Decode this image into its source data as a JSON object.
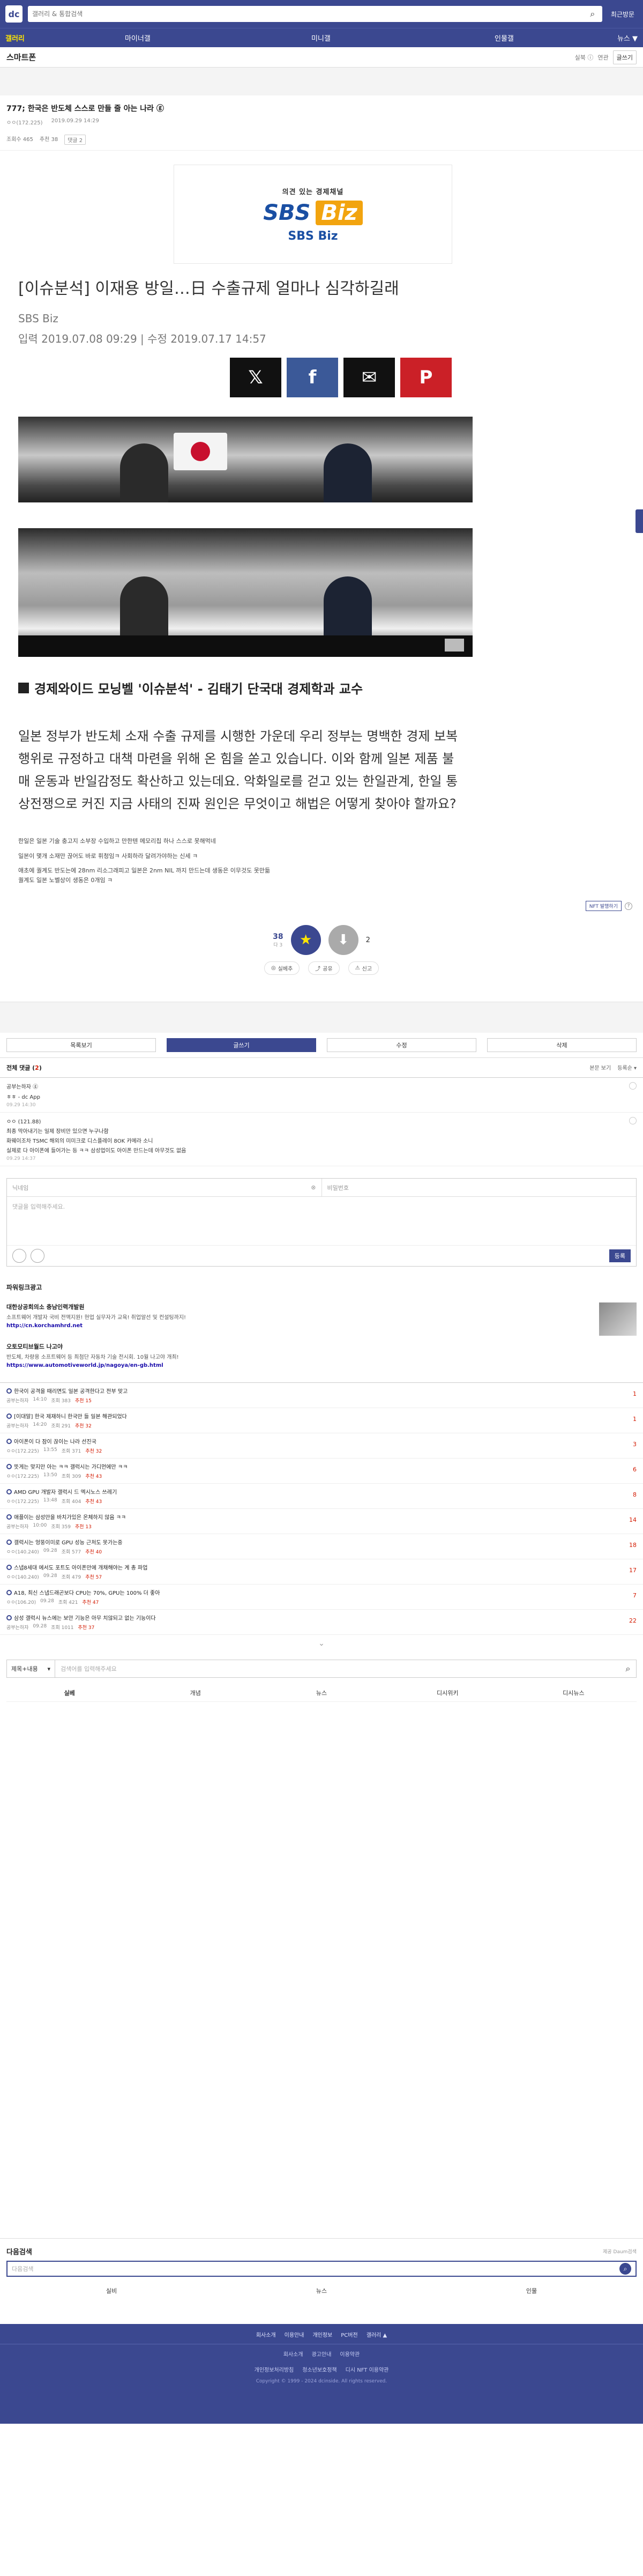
{
  "header": {
    "search_placeholder": "갤러리 & 통합검색",
    "recent_label": "최근방문"
  },
  "nav": {
    "items": [
      "갤러리",
      "마이너갤",
      "미니갤",
      "인물갤",
      "뉴스 ▼"
    ]
  },
  "gallery": {
    "title": "스마트폰",
    "tools": [
      "실북 ⓘ",
      "연관",
      "글쓰기"
    ]
  },
  "post": {
    "title": "777; 한국은 반도체 스스로 만들 줄 아는 나라 ⓖ",
    "author": "ㅇㅇ(172.225)",
    "date": "2019.09.29 14:29",
    "views": "조회수 465",
    "recommends": "추천 38",
    "comments_tag": "댓글 2"
  },
  "article": {
    "brand_sub": "의견 있는 경제채널",
    "brand_sbs": "SBS",
    "brand_biz": "Biz",
    "brand_foot": "SBS Biz",
    "title": "[이슈분석] 이재용 방일…日 수출규제 얼마나 심각하길래",
    "source": "SBS Biz",
    "dates": "입력 2019.07.08 09:29  |  수정 2019.07.17 14:57",
    "section_head": "경제와이드 모닝벨 '이슈분석' - 김태기 단국대 경제학과 교수",
    "lead": "일본 정부가 반도체 소재 수출 규제를 시행한 가운데 우리 정부는 명백한 경제 보복 행위로 규정하고 대책 마련을 위해 온 힘을 쏟고 있습니다. 이와 함께 일본 제품 불매 운동과 반일감정도 확산하고 있는데요. 악화일로를 걷고 있는 한일관계, 한일 통상전쟁으로 커진 지금 사태의 진짜 원인은 무엇이고 해법은 어떻게 찾아야 할까요?",
    "note1": "한일은 일본 기술 충고지 소부장 수입하고 만한텐 메모리칩 하나 스스로 못해먹네",
    "note2": "일본이 몇개 소재만 끊어도 바로 휘청임ㅋ 사회하라 달려가야하는 신세 ㅋ",
    "note3": "애초에 퀄계도 반도는에 28nm 리소그래피고 일본은 2nm NIL 까지 만드는데 생동은 이무것도 못만듦",
    "note4": "퀄계도 일본 노벨상이 생동은 0개임 ㅋ"
  },
  "share": {
    "x": "𝕏",
    "fb": "f",
    "mail": "✉",
    "pin": "P"
  },
  "vote": {
    "nft_label": "NFT 발행하기",
    "up_count": "38",
    "up_sub": "다 3",
    "down_count": "2",
    "actions": [
      "실베추",
      "공유",
      "신고"
    ]
  },
  "tabs": [
    "목록보기",
    "글쓰기",
    "수정",
    "삭제"
  ],
  "comments": {
    "title": "전체 댓글",
    "count": "2",
    "sort": [
      "본문 보기",
      "등록순 ▾"
    ],
    "items": [
      {
        "nick": "공부는하자 ⓖ",
        "text": "ㅎㅎ - dc App",
        "date": "09.29 14:30",
        "lines": []
      },
      {
        "nick": "ㅇㅇ (121.88)",
        "text": "",
        "date": "09.29 14:37",
        "lines": [
          "최종 막아내기는 일제 장비만 있으면 누구나함",
          "화웨이조차 TSMC 해외의 미미크로 디스플레이 8OK 카메라 소니",
          "실제로 다 아이폰에 들어가는 등 ㅋㅋ 삼성업이도 아이폰 만드는데 아무것도 없음"
        ]
      }
    ]
  },
  "write": {
    "nick_placeholder": "닉네임",
    "pw_placeholder": "비밀번호",
    "body_placeholder": "댓글을 입력해주세요.",
    "submit_label": "등록"
  },
  "powerlink": {
    "title": "파워링크광고",
    "ads": [
      {
        "name": "대한상공회의소 충남인력개발원",
        "desc": "소프트웨어 개발자 국비 전액지원! 현업 실무자가 교육! 취업알선 및 컨설팅까지!",
        "url": "http://cn.korchamhrd.net"
      },
      {
        "name": "오토모티브월드 나고야",
        "desc": "반도체, 차량용 소프트웨어 등 최첨단 자동차 기술 전시회. 10월 나고야 개최!",
        "url": "https://www.automotiveworld.jp/nagoya/en-gb.html"
      }
    ]
  },
  "posts": [
    {
      "title": "한국이 공격을 때리면도 일본 공격한다고 전부 맞고",
      "author": "공부는하자",
      "time": "14:10",
      "views": "조회 383",
      "rec": "추천 15",
      "cnt": "1"
    },
    {
      "title": "[이대말] 한국 제재하니 한국만 들 일본 해관되었다",
      "author": "공부는하자",
      "time": "14:20",
      "views": "조회 291",
      "rec": "추천 32",
      "cnt": "1"
    },
    {
      "title": "아이폰이 다 잠이 끊이는 나라 선진국",
      "author": "ㅇㅇ(172.225)",
      "time": "13:55",
      "views": "조회 371",
      "rec": "추천 32",
      "cnt": "3"
    },
    {
      "title": "뜻게는 맞지만 아는 ㅋㅋ 갤럭시는 가디먼에만 ㅋㅋ",
      "author": "ㅇㅇ(172.225)",
      "time": "13:50",
      "views": "조회 309",
      "rec": "추천 43",
      "cnt": "6"
    },
    {
      "title": "AMD GPU 개발자 갤럭시 드 엑시노스 쓰레기",
      "author": "ㅇㅇ(172.225)",
      "time": "13:48",
      "views": "조회 404",
      "rec": "추천 43",
      "cnt": "8"
    },
    {
      "title": "애플이는 삼성만을 바치가있은 온체하지 않음 ㅋㅋ",
      "author": "공부는하자",
      "time": "10:00",
      "views": "조회 359",
      "rec": "추천 13",
      "cnt": "14"
    },
    {
      "title": "갤럭시는 엉뚱이미로 GPU 성능 근처도 못가는중",
      "author": "ㅇㅇ(140.240)",
      "time": "09.28",
      "views": "조회 577",
      "rec": "추천 40",
      "cnt": "18"
    },
    {
      "title": "스냅8세대 에서도 포트도 아이폰만에 개채해야는 계 총 파업",
      "author": "ㅇㅇ(140.240)",
      "time": "09.28",
      "views": "조회 479",
      "rec": "추천 57",
      "cnt": "17"
    },
    {
      "title": "A18, 최신 스냅드래곤보다 CPU는 70%, GPU는 100% 더 좋아",
      "author": "ㅇㅇ(106.20)",
      "time": "09.28",
      "views": "조회 421",
      "rec": "추천 47",
      "cnt": "7"
    },
    {
      "title": "삼성 갤럭시 뉴스에는 보안 기능은 아무 치않되고 없는 기능이다",
      "author": "공부는하자",
      "time": "09.28",
      "views": "조회 1011",
      "rec": "추천 37",
      "cnt": "22"
    }
  ],
  "bottom_search": {
    "select_label": "제목+내용",
    "placeholder": "검색어를 입력해주세요",
    "tabs": [
      "실베",
      "개념",
      "뉴스",
      "디시위키",
      "디시뉴스"
    ]
  },
  "related": {
    "title": "다음검색",
    "source": "제공 Daum검색",
    "placeholder": "다음검색",
    "tabs": [
      "실비",
      "뉴스",
      "인물"
    ]
  },
  "footer": {
    "links": [
      "회사소개",
      "이용안내",
      "개인정보",
      "PC버전",
      "갤러리 ▲"
    ],
    "sub1": [
      "회사소개",
      "광고안내",
      "이용약관"
    ],
    "sub2": [
      "개인정보처리방침",
      "청소년보호정책",
      "디시 NFT 이용약관"
    ],
    "copy": "Copyright © 1999 - 2024 dcinside. All rights reserved."
  }
}
